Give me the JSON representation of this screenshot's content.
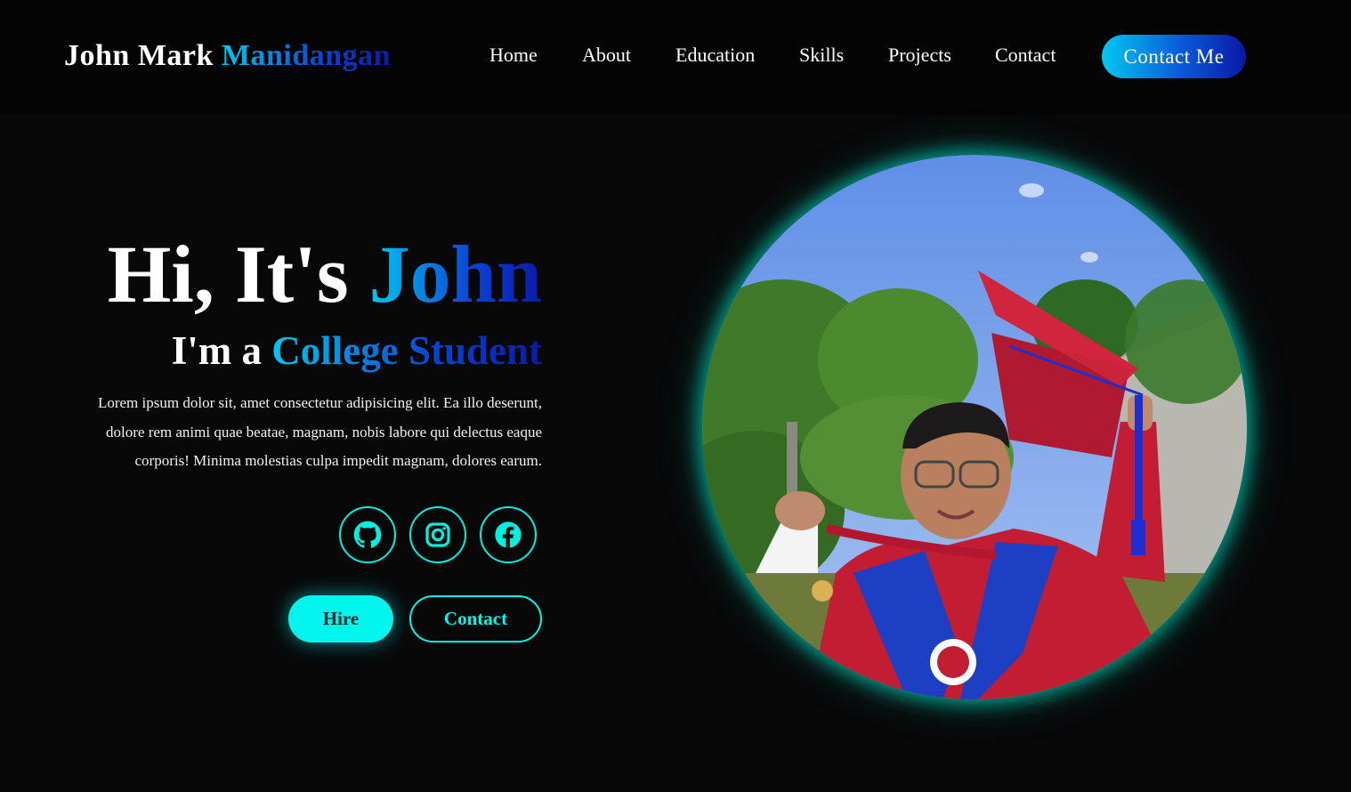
{
  "logo": {
    "first": "John Mark",
    "last": "Manidangan"
  },
  "nav": {
    "items": [
      "Home",
      "About",
      "Education",
      "Skills",
      "Projects",
      "Contact"
    ],
    "cta_label": "Contact Me"
  },
  "hero": {
    "greeting_prefix": "Hi, It's",
    "greeting_name": "John",
    "role_prefix": "I'm a",
    "role": "College Student",
    "description": "Lorem ipsum dolor sit, amet consectetur adipisicing elit. Ea illo deserunt, dolore rem animi quae beatae, magnam, nobis labore qui delectus eaque corporis! Minima molestias culpa impedit magnam, dolores earum.",
    "social_icons": [
      "github-icon",
      "instagram-icon",
      "facebook-icon"
    ],
    "hire_label": "Hire",
    "contact_label": "Contact"
  },
  "colors": {
    "accent": "#00f5ec",
    "gradient_start": "#00c8f0",
    "gradient_end": "#0b18a6",
    "background": "#080809"
  }
}
